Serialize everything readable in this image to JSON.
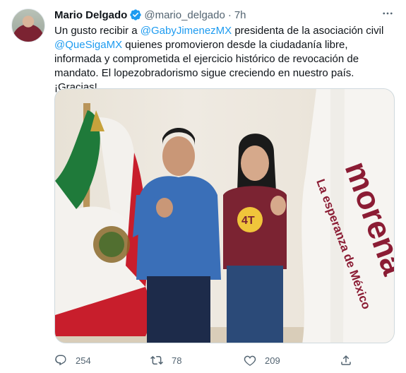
{
  "tweet": {
    "author_name": "Mario Delgado",
    "handle": "@mario_delgado",
    "separator": "·",
    "time": "7h",
    "text": {
      "part1": "Un gusto recibir a ",
      "mention1": "@GabyJimenezMX",
      "part2": " presidenta de la asociación civil ",
      "mention2": "@QueSigaMX",
      "part3": " quienes promovieron desde la ciudadanía libre, informada y comprometida el ejercicio histórico de revocación de mandato. El lopezobradorismo sigue creciendo en nuestro país. ¡Gracias!"
    },
    "media": {
      "flag_text_brand": "morena",
      "flag_text_tagline": "La esperanza de México",
      "shirt_text": "4T"
    },
    "actions": {
      "replies": "254",
      "retweets": "78",
      "likes": "209"
    }
  },
  "colors": {
    "link": "#1d9bf0",
    "verified": "#1d9bf0",
    "secondary_text": "#536471",
    "morena_brand": "#8b1c34"
  },
  "icons": [
    "verified-badge-icon",
    "more-icon",
    "reply-icon",
    "retweet-icon",
    "like-icon",
    "share-icon"
  ]
}
